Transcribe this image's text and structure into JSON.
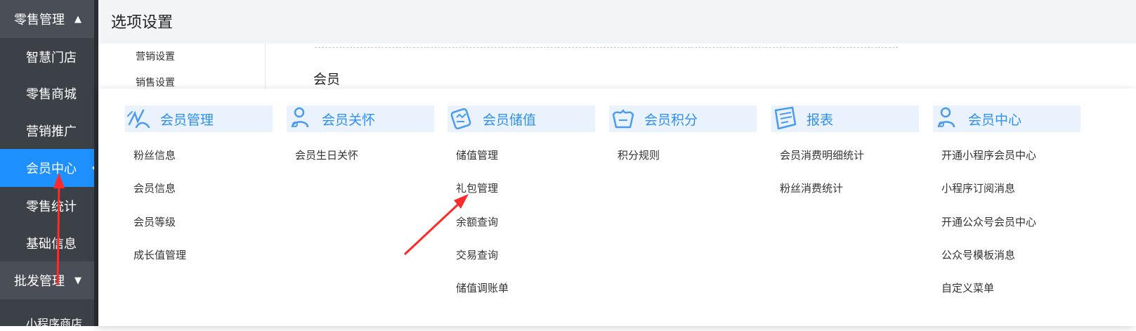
{
  "sidebar": {
    "group_retail": "零售管理",
    "items": [
      "智慧门店",
      "零售商城",
      "营销推广",
      "会员中心",
      "零售统计",
      "基础信息"
    ],
    "group_wholesale": "批发管理",
    "partial_item": "小程序商店"
  },
  "page": {
    "title": "选项设置",
    "subnav": [
      "营销设置",
      "销售设置"
    ],
    "section": "会员"
  },
  "menu": {
    "columns": [
      {
        "title": "会员管理",
        "icon": "member-manage-icon",
        "items": [
          "粉丝信息",
          "会员信息",
          "会员等级",
          "成长值管理"
        ]
      },
      {
        "title": "会员关怀",
        "icon": "member-care-icon",
        "items": [
          "会员生日关怀"
        ]
      },
      {
        "title": "会员储值",
        "icon": "member-deposit-icon",
        "items": [
          "储值管理",
          "礼包管理",
          "余额查询",
          "交易查询",
          "储值调账单"
        ]
      },
      {
        "title": "会员积分",
        "icon": "member-points-icon",
        "items": [
          "积分规则"
        ]
      },
      {
        "title": "报表",
        "icon": "report-icon",
        "items": [
          "会员消费明细统计",
          "粉丝消费统计"
        ]
      },
      {
        "title": "会员中心",
        "icon": "member-center-icon",
        "items": [
          "开通小程序会员中心",
          "小程序订阅消息",
          "开通公众号会员中心",
          "公众号模板消息",
          "自定义菜单"
        ]
      }
    ]
  },
  "colors": {
    "accent": "#1e90ff",
    "header_text": "#2f8ff0",
    "arrow": "#ff2a2a"
  }
}
